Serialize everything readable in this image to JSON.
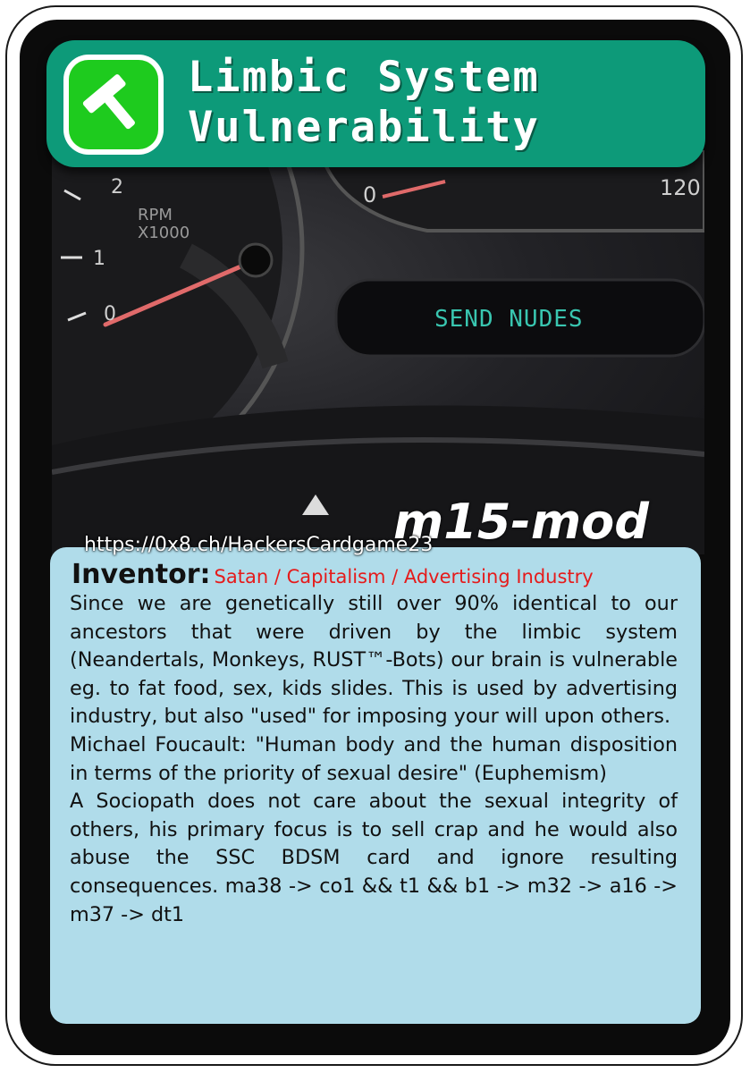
{
  "card": {
    "title_line1": "Limbic System",
    "title_line2": "Vulnerability",
    "icon": "hammer-icon",
    "accent_color": "#0d9a79",
    "icon_color": "#1ecb1e",
    "mod_label": "m15-mod",
    "url": "https://0x8.ch/HackersCardgame23",
    "photo": {
      "gauge_label_rpm": "RPM",
      "gauge_label_x1000": "X1000",
      "tick_2": "2",
      "tick_1": "1",
      "tick_0": "0",
      "tick_0_right": "0",
      "tick_120": "120",
      "display_text": "SEND NUDES"
    }
  },
  "inventor": {
    "label": "Inventor:",
    "value": "Satan / Capitalism / Advertising Industry"
  },
  "description": {
    "p1": "Since we are genetically still over 90% identical to our  ancestors that were driven by the limbic system (Neandertals, Monkeys, RUST™-Bots) our brain is vulnerable eg. to fat food, sex, kids slides. This is used by advertising industry, but also \"used\" for imposing your will upon others.",
    "p2": "Michael Foucault: \"Human body and the human disposition in terms of the priority of sexual desire\" (Euphemism)",
    "p3": "A Sociopath does not care about the sexual integrity of others, his primary focus is to sell crap and he would also abuse the SSC BDSM card and ignore resulting consequences.   ma38 -> co1 && t1 && b1 -> m32 -> a16 -> m37 -> dt1"
  }
}
